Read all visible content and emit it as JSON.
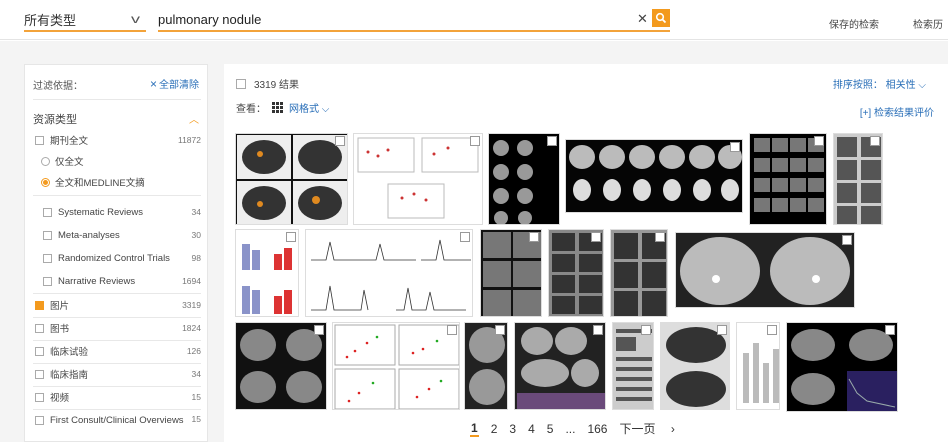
{
  "header": {
    "type_select": "所有类型",
    "search_value": "pulmonary nodule",
    "saved_searches": "保存的检索",
    "history": "检索历"
  },
  "sidebar": {
    "filter_label": "过滤依据：",
    "clear_all": "全部清除",
    "resource_type": "资源类型",
    "items": [
      {
        "label": "期刊全文",
        "count": "11872"
      },
      {
        "label": "仅全文"
      },
      {
        "label": "全文和MEDLINE文摘"
      },
      {
        "label": "Systematic Reviews",
        "count": "34"
      },
      {
        "label": "Meta-analyses",
        "count": "30"
      },
      {
        "label": "Randomized Control Trials",
        "count": "98"
      },
      {
        "label": "Narrative Reviews",
        "count": "1694"
      },
      {
        "label": "图片",
        "count": "3319"
      },
      {
        "label": "图书",
        "count": "1824"
      },
      {
        "label": "临床试验",
        "count": "126"
      },
      {
        "label": "临床指南",
        "count": "34"
      },
      {
        "label": "视频",
        "count": "15"
      },
      {
        "label": "First Consult/Clinical Overviews",
        "count": "15"
      }
    ]
  },
  "main": {
    "result_count": "3319 结果",
    "sort_label": "排序按照： 相关性",
    "view_label": "查看：",
    "view_mode": "网格式",
    "evaluate": "[+] 检索结果评价"
  },
  "pagination": {
    "pages": [
      "1",
      "2",
      "3",
      "4",
      "5",
      "...",
      "166"
    ],
    "next": "下一页"
  },
  "colors": {
    "accent": "#f39a1e",
    "link": "#2a6fb8"
  }
}
